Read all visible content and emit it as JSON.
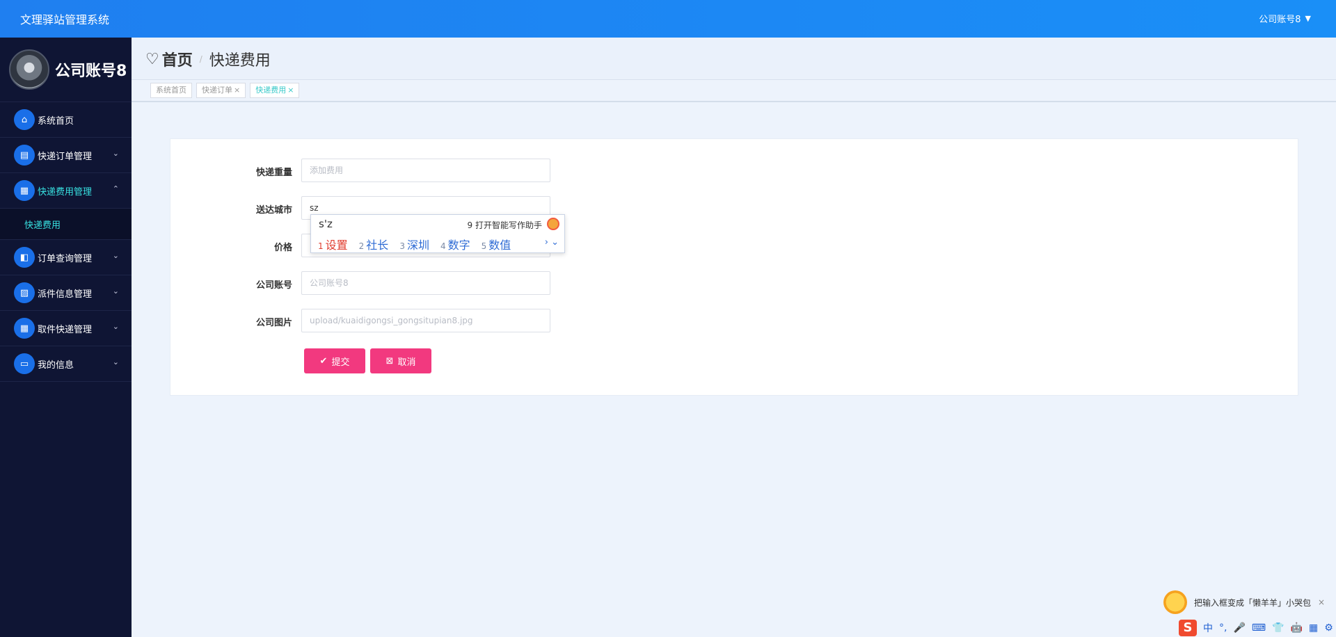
{
  "app": {
    "title": "文理驿站管理系统",
    "user_menu": "公司账号8"
  },
  "sidebar": {
    "profile_name": "公司账号8",
    "items": [
      {
        "label": "系统首页",
        "icon": "home-icon"
      },
      {
        "label": "快递订单管理",
        "icon": "clipboard-icon"
      },
      {
        "label": "快递费用管理",
        "icon": "grid-icon"
      },
      {
        "label": "快递费用",
        "icon": ""
      },
      {
        "label": "订单查询管理",
        "icon": "briefcase-icon"
      },
      {
        "label": "派件信息管理",
        "icon": "chart-icon"
      },
      {
        "label": "取件快递管理",
        "icon": "grid-icon"
      },
      {
        "label": "我的信息",
        "icon": "card-icon"
      }
    ]
  },
  "breadcrumb": {
    "home": "首页",
    "separator": "/",
    "current": "快递费用"
  },
  "tabs": [
    {
      "label": "系统首页"
    },
    {
      "label": "快递订单",
      "close": "×"
    },
    {
      "label": "快递费用",
      "close": "×"
    }
  ],
  "form": {
    "fields": [
      {
        "label": "快递重量",
        "value": "",
        "placeholder": "添加费用"
      },
      {
        "label": "送达城市",
        "value": "sz",
        "placeholder": ""
      },
      {
        "label": "价格",
        "value": "",
        "placeholder": ""
      },
      {
        "label": "公司账号",
        "value": "",
        "placeholder": "公司账号8"
      },
      {
        "label": "公司图片",
        "value": "",
        "placeholder": "upload/kuaidigongsi_gongsitupian8.jpg"
      }
    ],
    "submit_label": "提交",
    "cancel_label": "取消"
  },
  "ime": {
    "pinyin": "s'z",
    "assist": "9 打开智能写作助手",
    "candidates": [
      {
        "num": "1",
        "text": "设置"
      },
      {
        "num": "2",
        "text": "社长"
      },
      {
        "num": "3",
        "text": "深圳"
      },
      {
        "num": "4",
        "text": "数字"
      },
      {
        "num": "5",
        "text": "数值"
      }
    ],
    "nav": "› ⌄"
  },
  "notification": {
    "text": "把输入框变成「懒羊羊」小哭包",
    "close": "×"
  },
  "ime_toolbar": {
    "logo": "S",
    "mode": "中",
    "punct": "°,",
    "mic": "🎤",
    "keyboard": "⌨",
    "skin": "👕",
    "bot": "🤖",
    "apps": "▦",
    "settings": "⚙"
  },
  "colors": {
    "primary": "#1f7ff0",
    "sidebar": "#0f1534",
    "accent": "#38e2e2",
    "button": "#f2397f"
  }
}
